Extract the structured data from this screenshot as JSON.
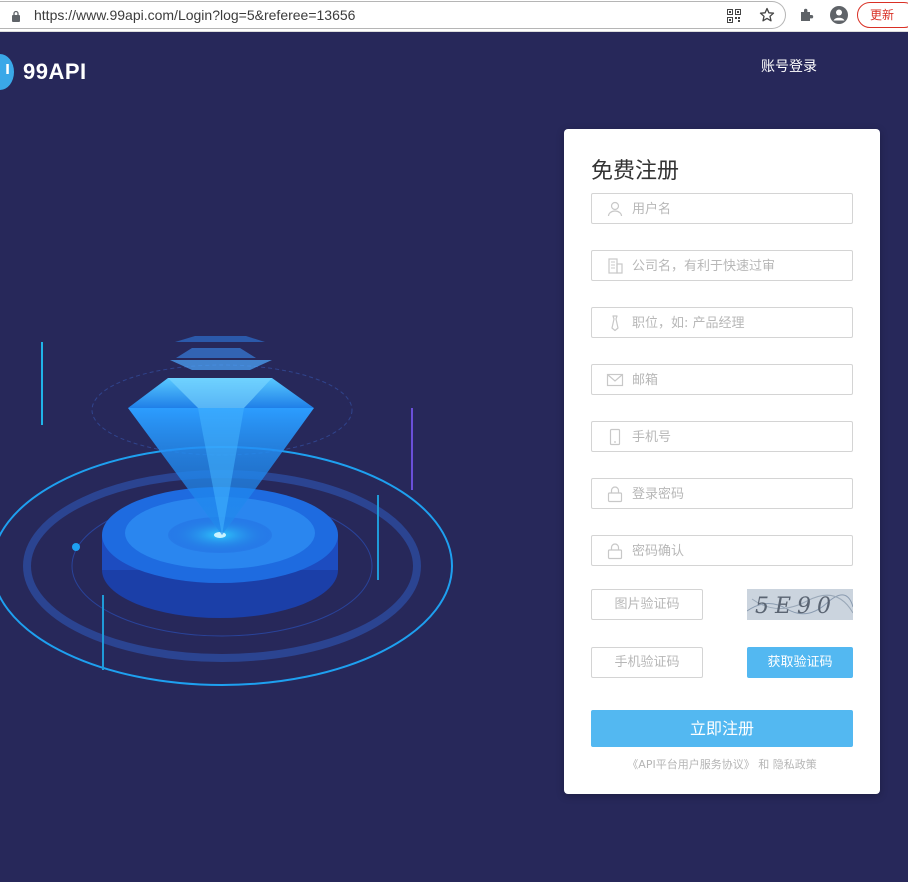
{
  "browser": {
    "url": "https://www.99api.com/Login?log=5&referee=13656",
    "update_label": "更新"
  },
  "header": {
    "logo_mark": "I",
    "logo_text": "99API",
    "login_link": "账号登录"
  },
  "form": {
    "title": "免费注册",
    "username_placeholder": "用户名",
    "company_placeholder": "公司名，有利于快速过审",
    "position_placeholder": "职位，如: 产品经理",
    "email_placeholder": "邮箱",
    "phone_placeholder": "手机号",
    "password_placeholder": "登录密码",
    "confirm_placeholder": "密码确认",
    "image_code_placeholder": "图片验证码",
    "captcha_text": "5E90",
    "sms_code_placeholder": "手机验证码",
    "get_code_label": "获取验证码",
    "submit_label": "立即注册",
    "agreement_link": "《API平台用户服务协议》",
    "agreement_and": "和",
    "privacy_link": "隐私政策"
  },
  "colors": {
    "page_bg": "#27285a",
    "accent": "#53b8f1",
    "card_bg": "#ffffff"
  }
}
